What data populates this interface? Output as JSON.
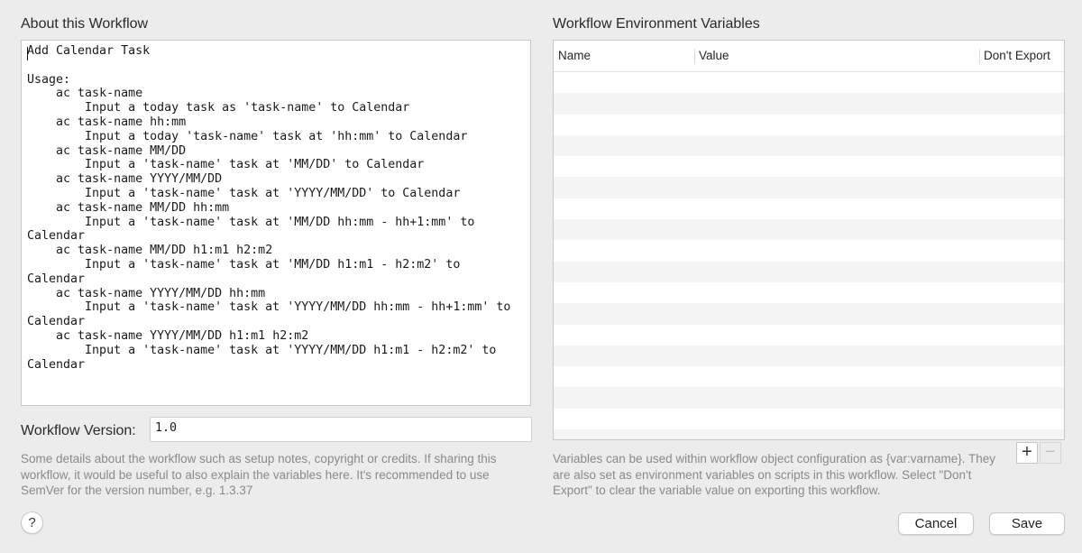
{
  "about": {
    "title": "About this Workflow",
    "text": "Add Calendar Task\n\nUsage:\n    ac task-name\n        Input a today task as 'task-name' to Calendar\n    ac task-name hh:mm\n        Input a today 'task-name' task at 'hh:mm' to Calendar\n    ac task-name MM/DD\n        Input a 'task-name' task at 'MM/DD' to Calendar\n    ac task-name YYYY/MM/DD\n        Input a 'task-name' task at 'YYYY/MM/DD' to Calendar\n    ac task-name MM/DD hh:mm\n        Input a 'task-name' task at 'MM/DD hh:mm - hh+1:mm' to Calendar\n    ac task-name MM/DD h1:m1 h2:m2\n        Input a 'task-name' task at 'MM/DD h1:m1 - h2:m2' to Calendar\n    ac task-name YYYY/MM/DD hh:mm\n        Input a 'task-name' task at 'YYYY/MM/DD hh:mm - hh+1:mm' to Calendar\n    ac task-name YYYY/MM/DD h1:m1 h2:m2\n        Input a 'task-name' task at 'YYYY/MM/DD h1:m1 - h2:m2' to Calendar"
  },
  "version": {
    "label": "Workflow Version:",
    "value": "1.0"
  },
  "help_left": "Some details about the workflow such as setup notes, copyright or credits. If sharing this workflow, it would be useful to also explain the variables here. It's recommended to use SemVer for the version number, e.g. 1.3.37",
  "env": {
    "title": "Workflow Environment Variables",
    "columns": [
      "Name",
      "Value",
      "Don't Export"
    ],
    "rows": [],
    "add_label": "+",
    "remove_label": "−",
    "help": "Variables can be used within workflow object configuration as {var:varname}. They are also set as environment variables on scripts in this workflow. Select \"Don't Export\" to clear the variable value on exporting this workflow."
  },
  "footer": {
    "help_label": "?",
    "cancel_label": "Cancel",
    "save_label": "Save"
  }
}
